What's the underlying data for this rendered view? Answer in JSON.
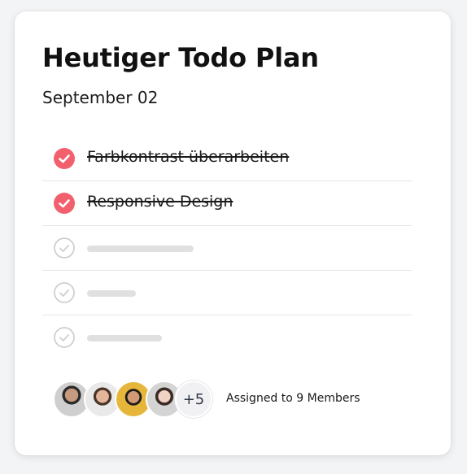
{
  "card": {
    "title": "Heutiger Todo Plan",
    "date": "September 02"
  },
  "todos": [
    {
      "label": "Farbkontrast überarbeiten",
      "done": true
    },
    {
      "label": "Responsive Design",
      "done": true
    },
    {
      "label": "",
      "done": false
    },
    {
      "label": "",
      "done": false
    },
    {
      "label": "",
      "done": false
    }
  ],
  "members": {
    "extra_count": "+5",
    "assigned_text": "Assigned to 9 Members"
  },
  "colors": {
    "done_check": "#f2606e",
    "pending_check": "#cfcfcf"
  }
}
